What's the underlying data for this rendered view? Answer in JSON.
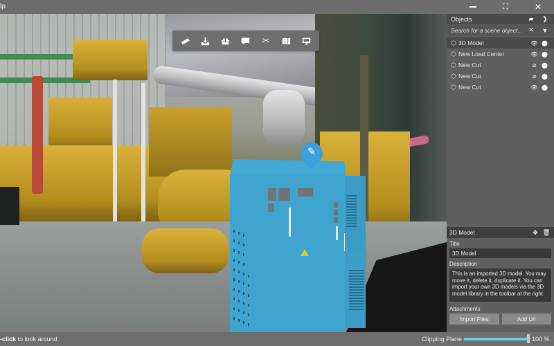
{
  "titlebar": {
    "app_title": "lp",
    "minimize_icon": "minimize-icon",
    "fullscreen_icon": "fullscreen-icon",
    "close_icon": "close-icon"
  },
  "toolbar": {
    "tools": [
      {
        "name": "measure-tool",
        "icon": "ruler-icon"
      },
      {
        "name": "import-tool",
        "icon": "download-tray-icon"
      },
      {
        "name": "models-tool",
        "icon": "boxes-icon"
      },
      {
        "name": "annotation-tool",
        "icon": "comment-icon"
      },
      {
        "name": "cut-tool",
        "icon": "scissors-icon"
      },
      {
        "name": "map-tool",
        "icon": "map-icon"
      },
      {
        "name": "presentation-tool",
        "icon": "presentation-icon"
      }
    ]
  },
  "objects_panel": {
    "header": "Objects",
    "search_placeholder": "Search for a scene object...",
    "items": [
      {
        "label": "3D Model",
        "visible": true,
        "selected": true
      },
      {
        "label": "New Load Center",
        "visible": true,
        "selected": false
      },
      {
        "label": "New Cut",
        "visible": false,
        "selected": false
      },
      {
        "label": "New Cut",
        "visible": false,
        "selected": false
      },
      {
        "label": "New Cut",
        "visible": true,
        "selected": false
      }
    ]
  },
  "properties_panel": {
    "header": "3D Model",
    "title_label": "Title",
    "title_value": "3D Model",
    "description_label": "Description",
    "description_value": "This is an imported 3D model. You may move it, delete it, duplicate it. You can import your own 3D models via the 3D model library in the toolbar at the right",
    "attachments_label": "Attachments",
    "import_files_label": "Import Files",
    "add_url_label": "Add Url"
  },
  "statusbar": {
    "hint_bold": "-click",
    "hint_rest": " to look around",
    "clipping_label": "Clipping Plane",
    "clipping_percent": 100,
    "clipping_value_text": "100 %"
  },
  "colors": {
    "model_blue": "#3fa5cf",
    "pin_blue": "#3aa0de",
    "slider_accent": "#6ec5e3",
    "panel_bg": "#5f5f5f"
  }
}
